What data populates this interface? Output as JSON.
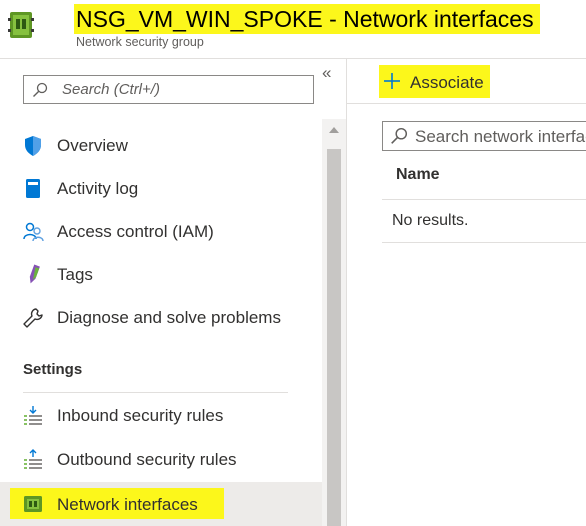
{
  "header": {
    "title": "NSG_VM_WIN_SPOKE - Network interfaces",
    "subtitle": "Network security group",
    "icon": "network-security-group-icon"
  },
  "sidebar": {
    "search_placeholder": "Search (Ctrl+/)",
    "collapse_glyph": "«",
    "items": [
      {
        "label": "Overview",
        "icon": "shield-icon"
      },
      {
        "label": "Activity log",
        "icon": "activity-log-icon"
      },
      {
        "label": "Access control (IAM)",
        "icon": "people-icon"
      },
      {
        "label": "Tags",
        "icon": "tag-icon"
      },
      {
        "label": "Diagnose and solve problems",
        "icon": "wrench-icon"
      }
    ],
    "section_settings": "Settings",
    "settings_items": [
      {
        "label": "Inbound security rules",
        "icon": "inbound-rules-icon"
      },
      {
        "label": "Outbound security rules",
        "icon": "outbound-rules-icon"
      },
      {
        "label": "Network interfaces",
        "icon": "network-interface-icon",
        "selected": true
      }
    ]
  },
  "main": {
    "associate_label": "Associate",
    "search_placeholder": "Search network interfaces",
    "columns": [
      "Name"
    ],
    "empty_text": "No results."
  },
  "colors": {
    "highlight": "#fcf71b",
    "accent_blue": "#0078d4",
    "selected_bg": "#edebe9",
    "border": "#8a8886"
  }
}
